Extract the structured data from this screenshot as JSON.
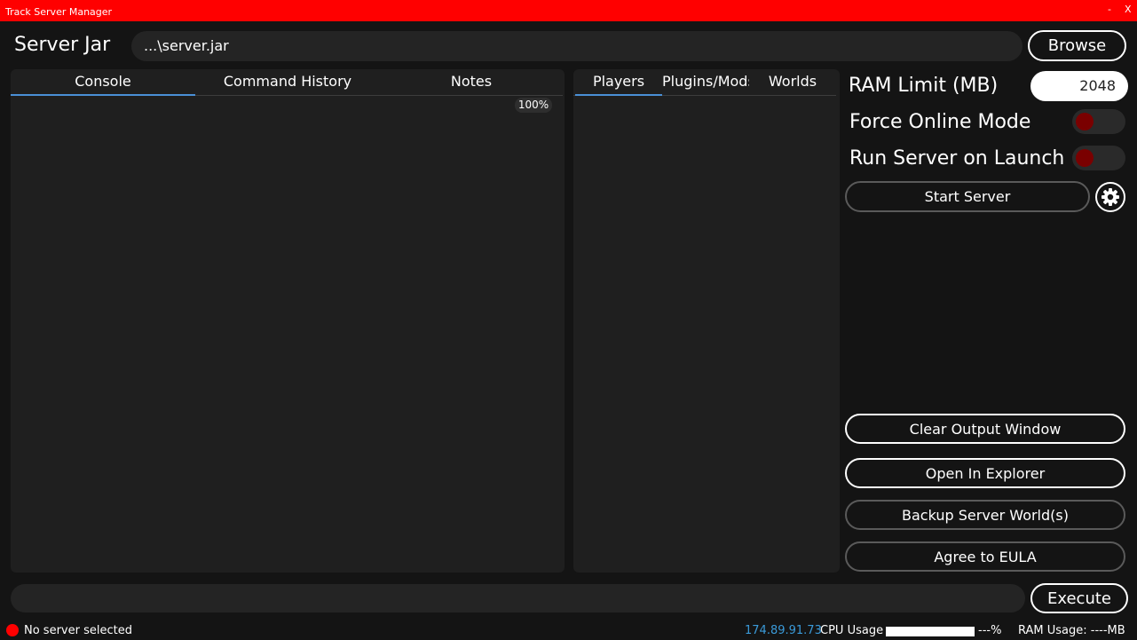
{
  "window": {
    "title": "Track Server Manager",
    "minimize": "-",
    "close": "X"
  },
  "header": {
    "server_jar_label": "Server Jar",
    "server_jar_path": "...\\server.jar",
    "browse_label": "Browse"
  },
  "left_panel": {
    "tabs": [
      {
        "label": "Console"
      },
      {
        "label": "Command History"
      },
      {
        "label": "Notes"
      }
    ],
    "zoom": "100%"
  },
  "middle_panel": {
    "tabs": [
      {
        "label": "Players"
      },
      {
        "label": "Plugins/Mods"
      },
      {
        "label": "Worlds"
      }
    ]
  },
  "settings": {
    "ram_limit_label": "RAM Limit (MB)",
    "ram_limit_value": "2048",
    "force_online_label": "Force Online Mode",
    "force_online_on": false,
    "run_on_launch_label": "Run Server on Launch",
    "run_on_launch_on": false,
    "start_label": "Start Server",
    "toggle_off_color": "#7a0000"
  },
  "actions": {
    "clear_output": "Clear Output Window",
    "open_explorer": "Open In Explorer",
    "backup_worlds": "Backup Server World(s)",
    "agree_eula": "Agree to EULA"
  },
  "command": {
    "execute_label": "Execute"
  },
  "status": {
    "server_state": "No server selected",
    "ip": "174.89.91.73",
    "cpu_label": "CPU Usage",
    "cpu_value": "---%",
    "ram_usage": "RAM Usage: ----MB"
  },
  "colors": {
    "titlebar": "#ff0000",
    "tab_active": "#4a8fd6",
    "ip_text": "#3a9ad9",
    "status_dot": "#ff0000"
  }
}
